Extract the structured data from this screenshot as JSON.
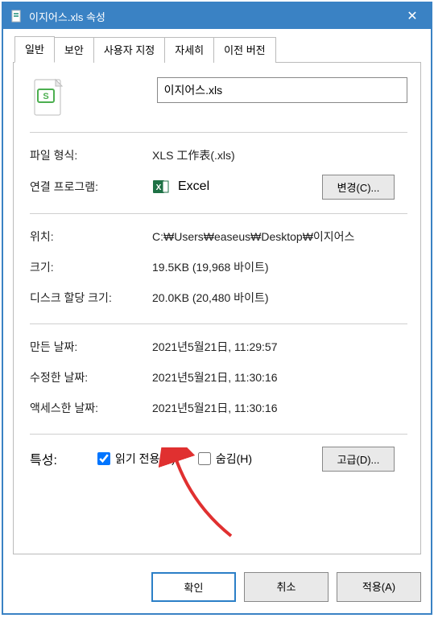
{
  "titlebar": {
    "title": "이지어스.xls 속성"
  },
  "tabs": {
    "general": "일반",
    "security": "보안",
    "custom": "사용자 지정",
    "details": "자세히",
    "previous": "이전 버전"
  },
  "header": {
    "filename": "이지어스.xls"
  },
  "rows": {
    "fileType_label": "파일 형식:",
    "fileType_value": "XLS 工作表(.xls)",
    "assoc_label": "연결 프로그램:",
    "assoc_value": "Excel",
    "change_btn": "변경(C)...",
    "location_label": "위치:",
    "location_value": "C:₩Users₩easeus₩Desktop₩이지어스",
    "size_label": "크기:",
    "size_value": "19.5KB (19,968 바이트)",
    "diskSize_label": "디스크 할당 크기:",
    "diskSize_value": "20.0KB (20,480 바이트)",
    "created_label": "만든 날짜:",
    "created_value": "2021년5월21日, 11:29:57",
    "modified_label": "수정한 날짜:",
    "modified_value": "2021년5월21日, 11:30:16",
    "accessed_label": "액세스한 날짜:",
    "accessed_value": "2021년5월21日, 11:30:16",
    "attrs_label": "특성:",
    "readonly_label": "읽기 전용(R)",
    "hidden_label": "숨김(H)",
    "advanced_btn": "고급(D)..."
  },
  "footer": {
    "ok": "확인",
    "cancel": "취소",
    "apply": "적용(A)"
  }
}
